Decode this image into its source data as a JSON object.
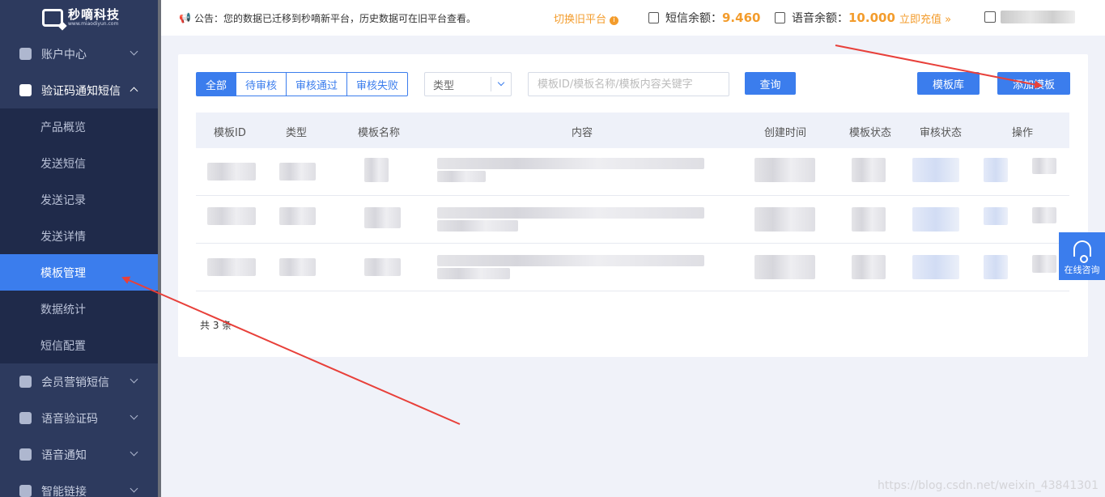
{
  "logo": {
    "name": "秒嘀科技",
    "url": "www.miaodiyun.com"
  },
  "sidebar": {
    "groups": [
      {
        "label": "账户中心"
      },
      {
        "label": "验证码通知短信"
      },
      {
        "label": "会员营销短信"
      },
      {
        "label": "语音验证码"
      },
      {
        "label": "语音通知"
      },
      {
        "label": "智能链接"
      }
    ],
    "sub_items": [
      {
        "label": "产品概览"
      },
      {
        "label": "发送短信"
      },
      {
        "label": "发送记录"
      },
      {
        "label": "发送详情"
      },
      {
        "label": "模板管理"
      },
      {
        "label": "数据统计"
      },
      {
        "label": "短信配置"
      }
    ]
  },
  "topbar": {
    "notice": "公告：您的数据已迁移到秒嘀新平台，历史数据可在旧平台查看。",
    "switch_old": "切换旧平台",
    "sms_balance_label": "短信余额：",
    "sms_balance_value": "9.460",
    "voice_balance_label": "语音余额：",
    "voice_balance_value": "10.000",
    "recharge": "立即充值 »"
  },
  "filters": {
    "tabs": [
      {
        "label": "全部"
      },
      {
        "label": "待审核"
      },
      {
        "label": "审核通过"
      },
      {
        "label": "审核失败"
      }
    ],
    "type_select": "类型",
    "search_placeholder": "模板ID/模板名称/模板内容关键字",
    "query_button": "查询",
    "library_button": "模板库",
    "add_button": "添加模板"
  },
  "table": {
    "headers": [
      "模板ID",
      "类型",
      "模板名称",
      "内容",
      "创建时间",
      "模板状态",
      "审核状态",
      "操作"
    ],
    "total": "共 3 条"
  },
  "consult": {
    "label": "在线咨询"
  },
  "watermark": "https://blog.csdn.net/weixin_43841301",
  "colors": {
    "primary": "#3b7ded",
    "sidebar": "#2d3a5e",
    "accent": "#f39c2c",
    "arrow": "#e8403a"
  }
}
